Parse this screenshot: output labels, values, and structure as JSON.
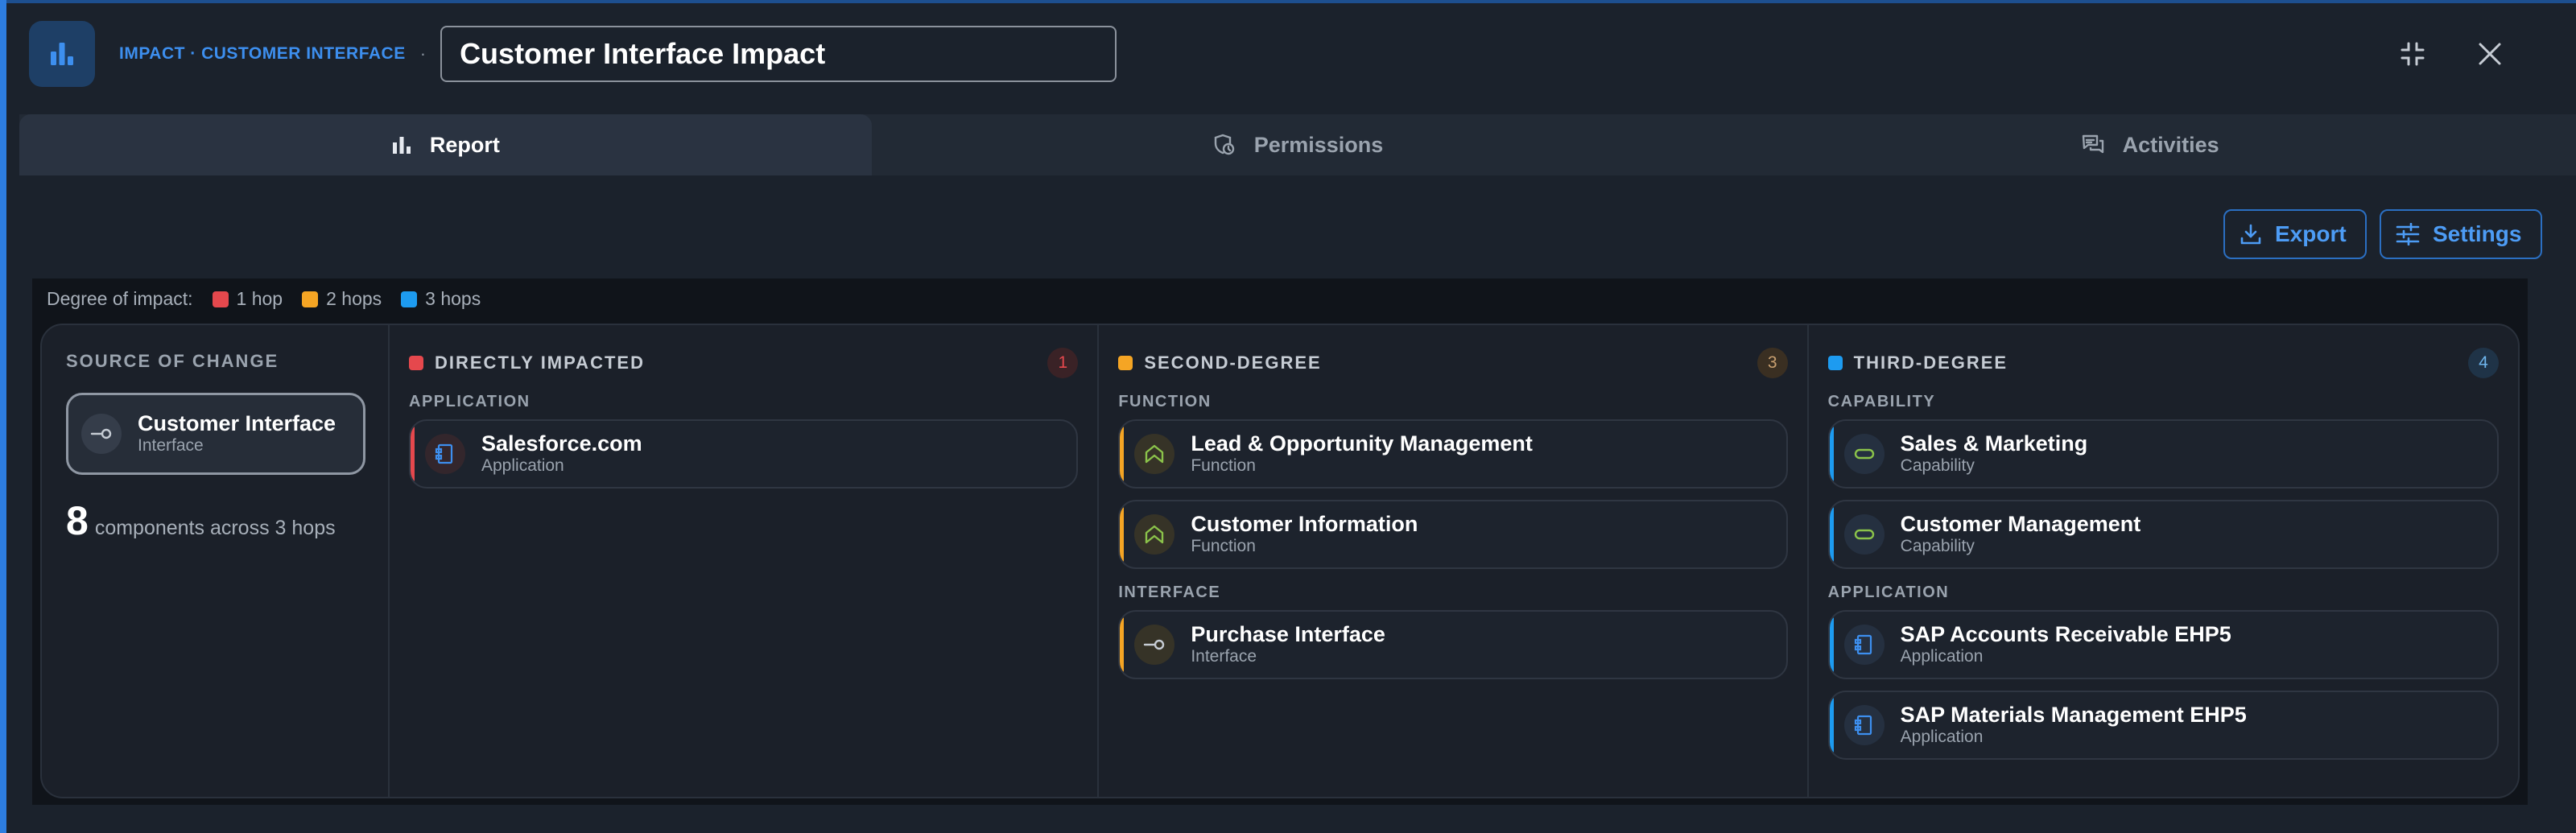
{
  "header": {
    "breadcrumb": "IMPACT · CUSTOMER INTERFACE",
    "separator": "·",
    "title_value": "Customer Interface Impact"
  },
  "tabs": [
    {
      "label": "Report",
      "icon": "bar-chart-icon",
      "active": true
    },
    {
      "label": "Permissions",
      "icon": "shield-clock-icon",
      "active": false
    },
    {
      "label": "Activities",
      "icon": "chat-icon",
      "active": false
    }
  ],
  "toolbar": {
    "export_label": "Export",
    "settings_label": "Settings"
  },
  "legend": {
    "title": "Degree of impact:",
    "items": [
      {
        "label": "1 hop",
        "color": "#e5484d"
      },
      {
        "label": "2 hops",
        "color": "#f5a524"
      },
      {
        "label": "3 hops",
        "color": "#1d9bf0"
      }
    ]
  },
  "source": {
    "title": "SOURCE OF CHANGE",
    "name": "Customer Interface",
    "type": "Interface",
    "count": "8",
    "count_label": "components across 3 hops"
  },
  "columns": [
    {
      "title": "DIRECTLY IMPACTED",
      "count": "1",
      "color": "#e5484d",
      "groups": [
        {
          "label": "APPLICATION",
          "items": [
            {
              "name": "Salesforce.com",
              "type": "Application",
              "icon": "application-icon"
            }
          ]
        }
      ]
    },
    {
      "title": "SECOND-DEGREE",
      "count": "3",
      "color": "#f5a524",
      "groups": [
        {
          "label": "FUNCTION",
          "items": [
            {
              "name": "Lead & Opportunity Management",
              "type": "Function",
              "icon": "function-icon"
            },
            {
              "name": "Customer Information",
              "type": "Function",
              "icon": "function-icon"
            }
          ]
        },
        {
          "label": "INTERFACE",
          "items": [
            {
              "name": "Purchase Interface",
              "type": "Interface",
              "icon": "interface-icon"
            }
          ]
        }
      ]
    },
    {
      "title": "THIRD-DEGREE",
      "count": "4",
      "color": "#1d9bf0",
      "groups": [
        {
          "label": "CAPABILITY",
          "items": [
            {
              "name": "Sales & Marketing",
              "type": "Capability",
              "icon": "capability-icon"
            },
            {
              "name": "Customer Management",
              "type": "Capability",
              "icon": "capability-icon"
            }
          ]
        },
        {
          "label": "APPLICATION",
          "items": [
            {
              "name": "SAP Accounts Receivable EHP5",
              "type": "Application",
              "icon": "application-icon"
            },
            {
              "name": "SAP Materials Management EHP5",
              "type": "Application",
              "icon": "application-icon"
            }
          ]
        }
      ]
    }
  ]
}
